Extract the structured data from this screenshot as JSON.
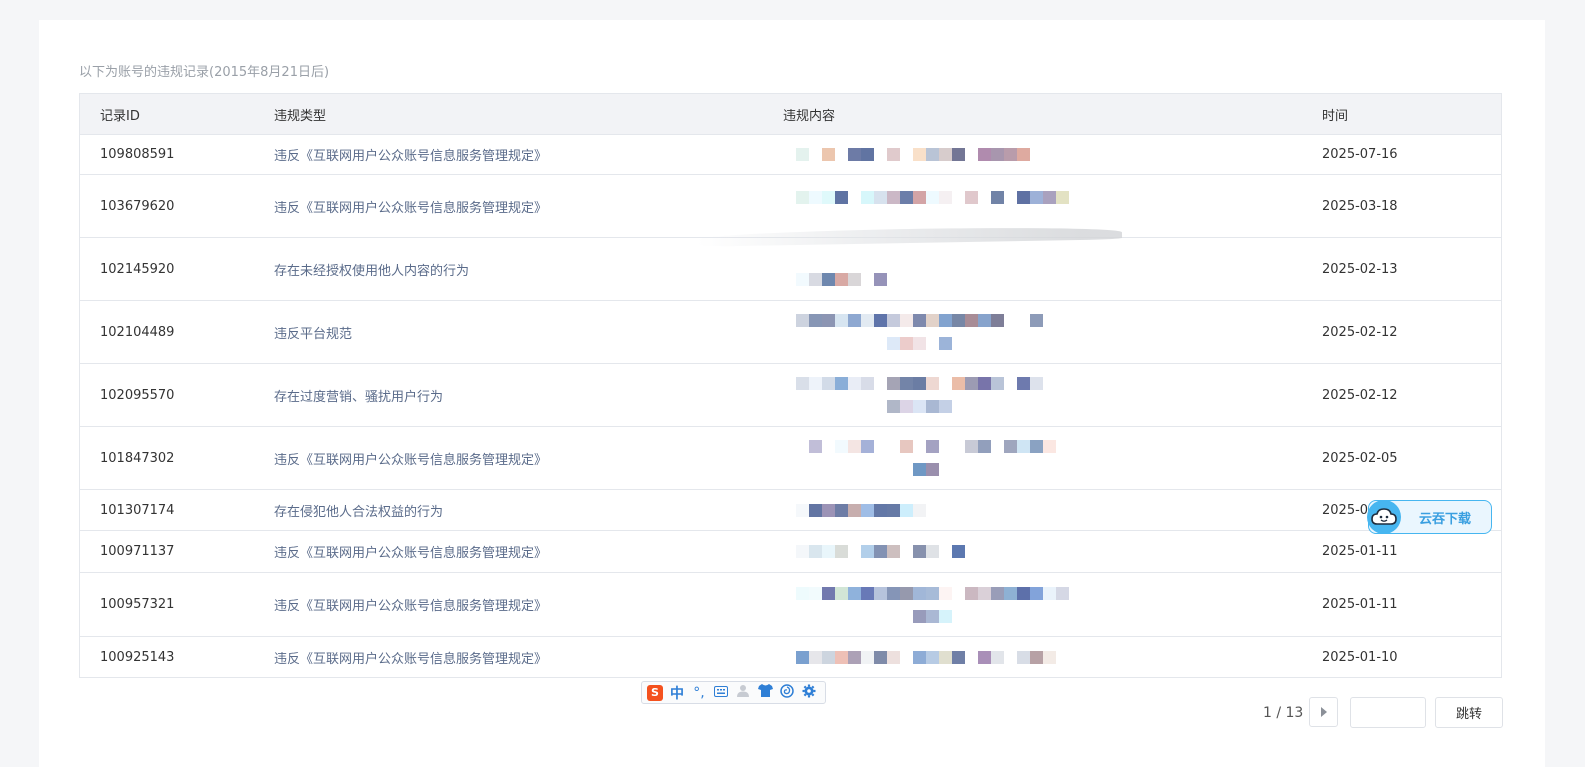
{
  "caption": "以下为账号的违规记录(2015年8月21日后)",
  "table": {
    "headers": [
      "记录ID",
      "违规类型",
      "违规内容",
      "时间"
    ],
    "rows": [
      {
        "id": "109808591",
        "type": "违反《互联网用户公众账号信息服务管理规定》",
        "date": "2025-07-16"
      },
      {
        "id": "103679620",
        "type": "违反《互联网用户公众账号信息服务管理规定》",
        "date": "2025-03-18"
      },
      {
        "id": "102145920",
        "type": "存在未经授权使用他人内容的行为",
        "date": "2025-02-13"
      },
      {
        "id": "102104489",
        "type": "违反平台规范",
        "date": "2025-02-12"
      },
      {
        "id": "102095570",
        "type": "存在过度营销、骚扰用户行为",
        "date": "2025-02-12"
      },
      {
        "id": "101847302",
        "type": "违反《互联网用户公众账号信息服务管理规定》",
        "date": "2025-02-05"
      },
      {
        "id": "101307174",
        "type": "存在侵犯他人合法权益的行为",
        "date": "2025-0"
      },
      {
        "id": "100971137",
        "type": "违反《互联网用户公众账号信息服务管理规定》",
        "date": "2025-01-11"
      },
      {
        "id": "100957321",
        "type": "违反《互联网用户公众账号信息服务管理规定》",
        "date": "2025-01-11"
      },
      {
        "id": "100925143",
        "type": "违反《互联网用户公众账号信息服务管理规定》",
        "date": "2025-01-10"
      }
    ]
  },
  "fab": {
    "label": "云吞下载",
    "icon": "cloud-face-icon"
  },
  "ime": {
    "lang_label": "中",
    "icons": [
      "sogou-logo-icon",
      "punctuation-icon",
      "keyboard-icon",
      "user-icon",
      "shirt-icon",
      "spiral-icon",
      "gear-icon"
    ]
  },
  "pagination": {
    "page_text": "1 / 13",
    "jump_label": "跳转",
    "jump_value": ""
  },
  "colors": {
    "accent": "#47b6f0",
    "link": "#5a6b8a",
    "border": "#e4e7ec",
    "header_bg": "#f2f3f6"
  }
}
